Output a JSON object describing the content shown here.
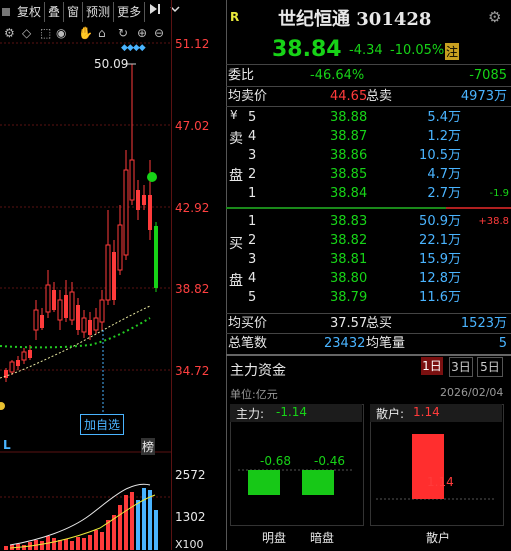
{
  "toolbar": {
    "items": [
      "复权",
      "叠",
      "窗",
      "预测",
      "更多"
    ],
    "tail_icon": "play-last-icon"
  },
  "price_axis": [
    "51.12",
    "47.02",
    "42.92",
    "38.82",
    "34.72"
  ],
  "volume_axis": [
    "2572",
    "1302",
    "X100"
  ],
  "chart": {
    "high_label": "50.09",
    "add_watch": "加自选",
    "bang": "榜",
    "left_l": "L"
  },
  "header": {
    "badge": "R",
    "stock_name": "世纪恒通 301428",
    "price": "38.84",
    "change": "-4.34",
    "change_pct": "-10.05%",
    "note": "注"
  },
  "ratio": {
    "label": "委比",
    "value": "-46.64%",
    "diff": "-7085"
  },
  "sell_avg": {
    "label": "均卖价",
    "price": "44.65",
    "total_label": "总卖",
    "total": "4973万"
  },
  "sell_label_chars": [
    "¥",
    "卖",
    "盘"
  ],
  "sell_orders": [
    {
      "level": "5",
      "price": "38.88",
      "vol": "5.4万",
      "extra": ""
    },
    {
      "level": "4",
      "price": "38.87",
      "vol": "1.2万",
      "extra": ""
    },
    {
      "level": "3",
      "price": "38.86",
      "vol": "10.5万",
      "extra": ""
    },
    {
      "level": "2",
      "price": "38.85",
      "vol": "4.7万",
      "extra": ""
    },
    {
      "level": "1",
      "price": "38.84",
      "vol": "2.7万",
      "extra": "-1.9"
    }
  ],
  "buy_label_chars": [
    "买",
    "盘"
  ],
  "buy_orders": [
    {
      "level": "1",
      "price": "38.83",
      "vol": "50.9万",
      "extra": "+38.8"
    },
    {
      "level": "2",
      "price": "38.82",
      "vol": "22.1万",
      "extra": ""
    },
    {
      "level": "3",
      "price": "38.81",
      "vol": "15.9万",
      "extra": ""
    },
    {
      "level": "4",
      "price": "38.80",
      "vol": "12.8万",
      "extra": ""
    },
    {
      "level": "5",
      "price": "38.79",
      "vol": "11.6万",
      "extra": ""
    }
  ],
  "buy_avg": {
    "label": "均买价",
    "price": "37.57",
    "total_label": "总买",
    "total": "1523万"
  },
  "trades": {
    "label": "总笔数",
    "value": "23432",
    "avg_label": "均笔量",
    "avg": "5"
  },
  "fund": {
    "title": "主力资金",
    "tabs": [
      "1日",
      "3日",
      "5日"
    ],
    "unit": "单位:亿元",
    "date": "2026/02/04",
    "main_label": "主力:",
    "main_value": "-1.14",
    "retail_label": "散户:",
    "retail_value": "1.14",
    "bar_values": [
      "-0.68",
      "-0.46",
      "1.14"
    ],
    "bar_labels": [
      "明盘",
      "暗盘",
      "散户"
    ]
  },
  "colors": {
    "up": "#ff3b3b",
    "down": "#17d317",
    "vol": "#4ab4ff"
  }
}
